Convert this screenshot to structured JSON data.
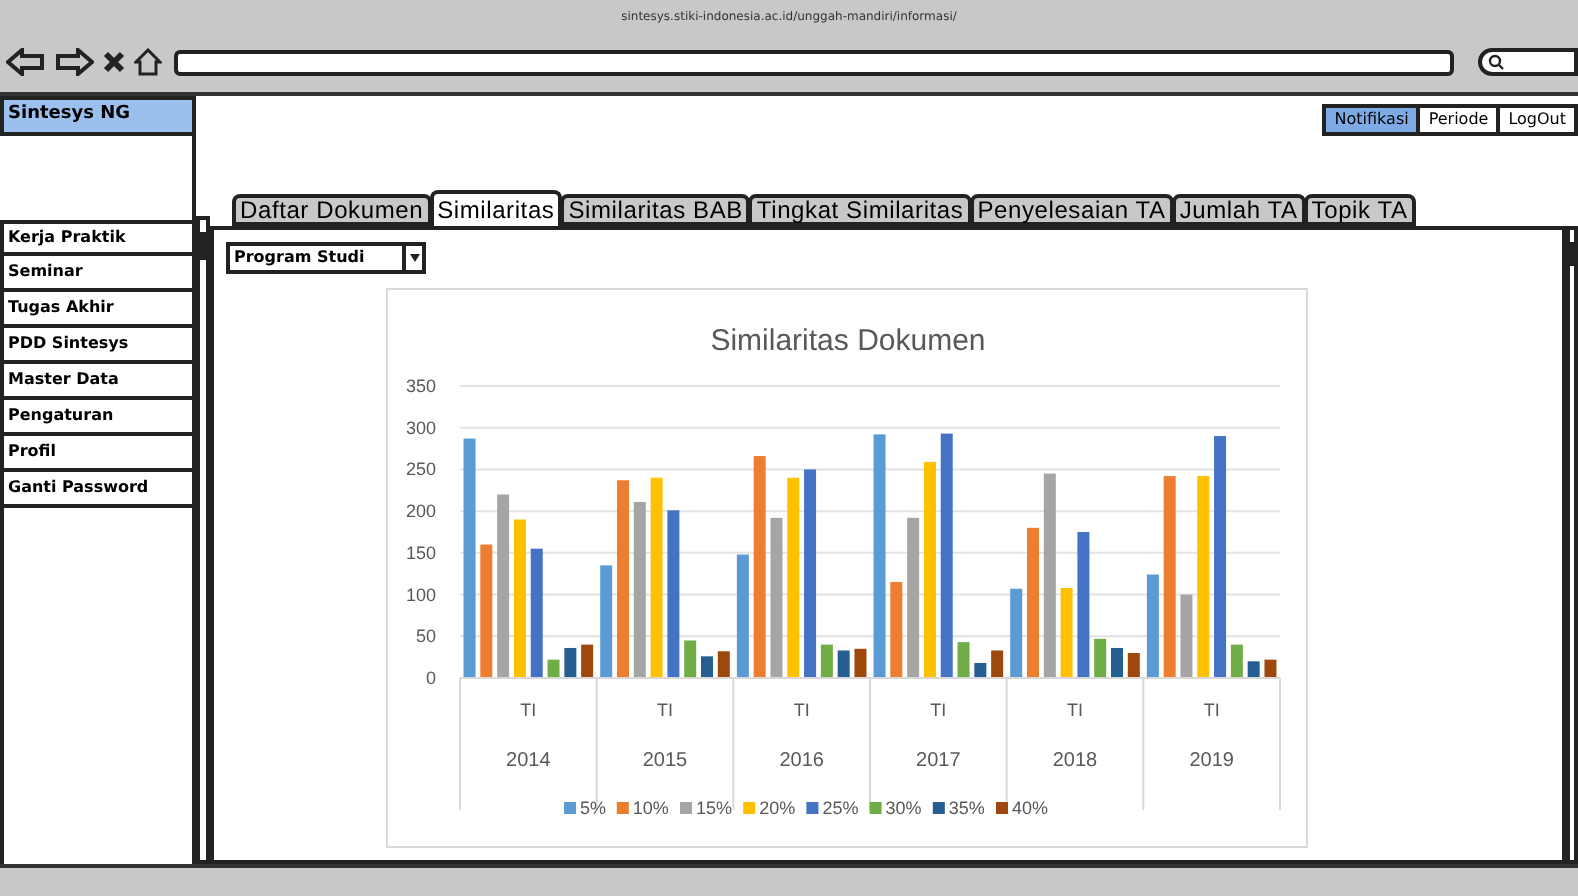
{
  "browser": {
    "url": "sintesys.stiki-indonesia.ac.id/unggah-mandiri/informasi/"
  },
  "app_title": "Sintesys NG",
  "top_buttons": [
    {
      "label": "Notifikasi",
      "selected": true
    },
    {
      "label": "Periode",
      "selected": false
    },
    {
      "label": "LogOut",
      "selected": false
    }
  ],
  "sidebar": {
    "items": [
      {
        "label": "Kerja Praktik"
      },
      {
        "label": "Seminar"
      },
      {
        "label": "Tugas Akhir"
      },
      {
        "label": "PDD Sintesys"
      },
      {
        "label": "Master Data"
      },
      {
        "label": "Pengaturan"
      },
      {
        "label": "Profil"
      },
      {
        "label": "Ganti Password"
      }
    ]
  },
  "tabs": [
    {
      "label": "Daftar Dokumen",
      "selected": false
    },
    {
      "label": "Similaritas",
      "selected": true
    },
    {
      "label": "Similaritas BAB",
      "selected": false
    },
    {
      "label": "Tingkat Similaritas",
      "selected": false
    },
    {
      "label": "Penyelesaian TA",
      "selected": false
    },
    {
      "label": "Jumlah TA",
      "selected": false
    },
    {
      "label": "Topik TA",
      "selected": false
    }
  ],
  "filter": {
    "value": "Program Studi"
  },
  "chart_data": {
    "type": "bar",
    "title": "Similaritas Dokumen",
    "categories": [
      "2014",
      "2015",
      "2016",
      "2017",
      "2018",
      "2019"
    ],
    "annotations": [
      "TI",
      "TI",
      "TI",
      "TI",
      "TI",
      "TI"
    ],
    "grid": true,
    "legend": "bottom",
    "ylim": [
      0,
      350
    ],
    "yticks": [
      0,
      50,
      100,
      150,
      200,
      250,
      300,
      350
    ],
    "series": [
      {
        "name": "5%",
        "color": "#5b9bd5",
        "values": [
          287,
          135,
          148,
          292,
          107,
          124
        ]
      },
      {
        "name": "10%",
        "color": "#ed7d31",
        "values": [
          160,
          237,
          266,
          115,
          180,
          242
        ]
      },
      {
        "name": "15%",
        "color": "#a5a5a5",
        "values": [
          220,
          211,
          192,
          192,
          245,
          100
        ]
      },
      {
        "name": "20%",
        "color": "#ffc000",
        "values": [
          190,
          240,
          240,
          259,
          108,
          242
        ]
      },
      {
        "name": "25%",
        "color": "#4472c4",
        "values": [
          155,
          201,
          250,
          293,
          175,
          290
        ]
      },
      {
        "name": "30%",
        "color": "#70ad47",
        "values": [
          22,
          45,
          40,
          43,
          47,
          40
        ]
      },
      {
        "name": "35%",
        "color": "#255e91",
        "values": [
          36,
          26,
          33,
          18,
          36,
          20
        ]
      },
      {
        "name": "40%",
        "color": "#9e480e",
        "values": [
          40,
          32,
          35,
          33,
          30,
          22
        ]
      }
    ]
  }
}
